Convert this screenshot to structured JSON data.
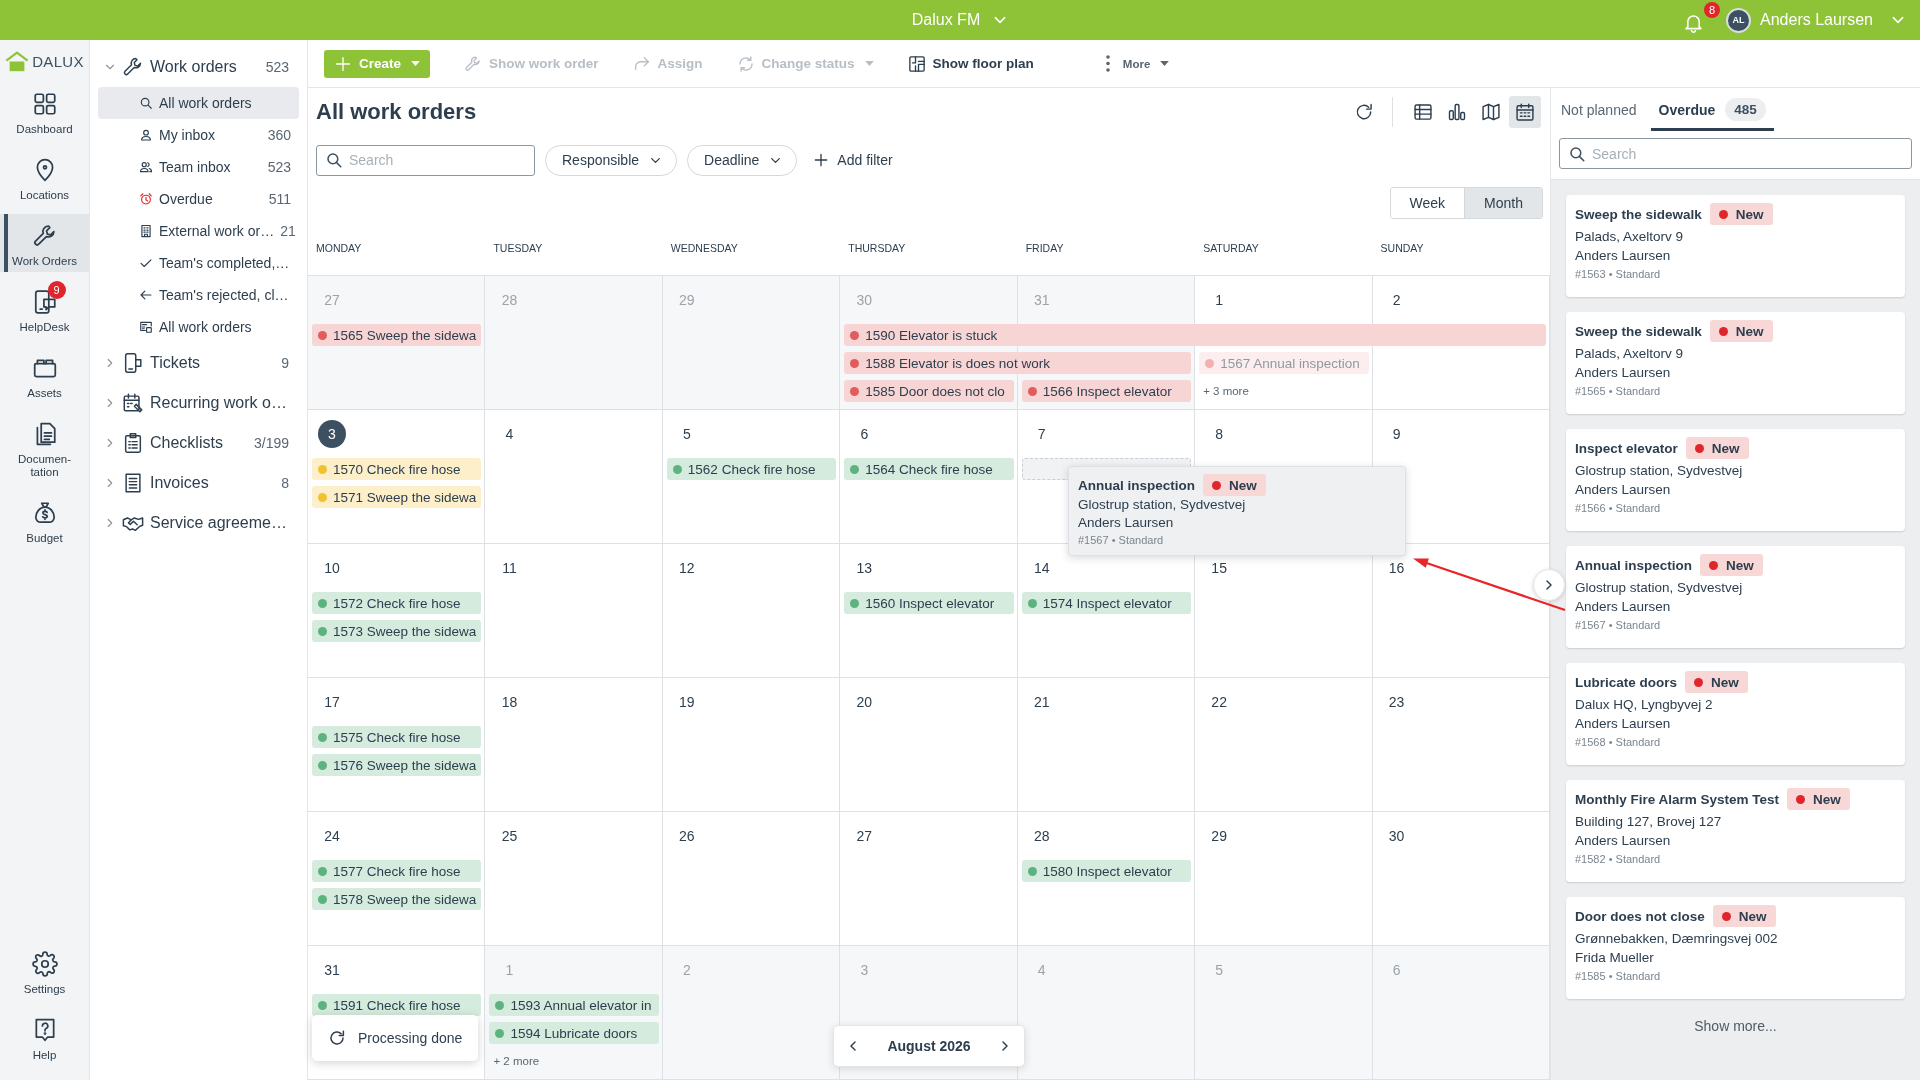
{
  "top_bar": {
    "title": "Dalux FM",
    "notification_count": "8",
    "user": {
      "initials": "AL",
      "name": "Anders Laursen"
    }
  },
  "rail": {
    "logo": "DALUX",
    "items": [
      {
        "label": "Dashboard",
        "selected": false
      },
      {
        "label": "Locations",
        "selected": false
      },
      {
        "label": "Work Orders",
        "selected": true
      },
      {
        "label": "HelpDesk",
        "selected": false,
        "badge": "9"
      },
      {
        "label": "Assets",
        "selected": false
      },
      {
        "label": "Documen-tation",
        "selected": false
      },
      {
        "label": "Budget",
        "selected": false
      }
    ],
    "bottom_items": [
      {
        "label": "Settings"
      },
      {
        "label": "Help"
      }
    ]
  },
  "tree": [
    {
      "label": "Work orders",
      "count": "523",
      "expanded": true,
      "selected": false,
      "children": [
        {
          "label": "All work orders",
          "selected": true
        },
        {
          "label": "My inbox",
          "count": "360",
          "selected": false
        },
        {
          "label": "Team inbox",
          "count": "523",
          "selected": false
        },
        {
          "label": "Overdue",
          "count": "511",
          "selected": false
        },
        {
          "label": "External work or…",
          "count": "21",
          "selected": false
        },
        {
          "label": "Team's completed,…",
          "selected": false
        },
        {
          "label": "Team's rejected, cl…",
          "selected": false
        },
        {
          "label": "All work orders",
          "selected": false
        }
      ]
    },
    {
      "label": "Tickets",
      "count": "9",
      "expanded": false,
      "selected": false
    },
    {
      "label": "Recurring work o…",
      "expanded": false,
      "selected": false
    },
    {
      "label": "Checklists",
      "count": "3/199",
      "expanded": false,
      "selected": false
    },
    {
      "label": "Invoices",
      "count": "8",
      "expanded": false,
      "selected": false
    },
    {
      "label": "Service agreeme…",
      "expanded": false,
      "selected": false
    }
  ],
  "toolbar": {
    "actions": [
      {
        "label": "Create",
        "kind": "primary",
        "disabled": false,
        "dropdown": true
      },
      {
        "label": "Show work order",
        "kind": "plain",
        "disabled": true,
        "dropdown": false
      },
      {
        "label": "Assign",
        "kind": "plain",
        "disabled": true,
        "dropdown": false
      },
      {
        "label": "Change status",
        "kind": "plain",
        "disabled": true,
        "dropdown": true
      },
      {
        "label": "Show floor plan",
        "kind": "plain",
        "disabled": false,
        "dropdown": false
      },
      {
        "label": "More",
        "kind": "plain",
        "disabled": false,
        "dropdown": true
      }
    ]
  },
  "header": {
    "title": "All work orders",
    "views": [
      {
        "selected": false
      },
      {
        "selected": false
      },
      {
        "selected": false
      },
      {
        "selected": true
      }
    ],
    "search": {
      "placeholder": "Search"
    },
    "filters": [
      {
        "label": "Responsible"
      },
      {
        "label": "Deadline"
      }
    ],
    "add_filter": "Add filter",
    "ranges": [
      {
        "label": "Week",
        "selected": false
      },
      {
        "label": "Month",
        "selected": true
      }
    ]
  },
  "calendar": {
    "weekdays": [
      "MONDAY",
      "TUESDAY",
      "WEDNESDAY",
      "THURSDAY",
      "FRIDAY",
      "SATURDAY",
      "SUNDAY"
    ],
    "weeks": [
      {
        "days": [
          {
            "date": "27",
            "outside": true,
            "today": false
          },
          {
            "date": "28",
            "outside": true,
            "today": false
          },
          {
            "date": "29",
            "outside": true,
            "today": false
          },
          {
            "date": "30",
            "outside": true,
            "today": false
          },
          {
            "date": "31",
            "outside": true,
            "today": false
          },
          {
            "date": "1",
            "outside": false,
            "today": false
          },
          {
            "date": "2",
            "outside": false,
            "today": false
          }
        ],
        "lanes": [
          [
            {
              "kind": "event",
              "text": "1565 Sweep the sidewa",
              "color": "#e25c5c",
              "dragging": false
            },
            {
              "kind": "empty"
            },
            {
              "kind": "empty"
            },
            {
              "kind": "event",
              "text": "1590 Elevator is stuck",
              "color": "#e25c5c",
              "dragging": false
            },
            {
              "kind": "continue"
            },
            {
              "kind": "continue"
            },
            {
              "kind": "continue"
            }
          ],
          [
            {
              "kind": "empty"
            },
            {
              "kind": "empty"
            },
            {
              "kind": "empty"
            },
            {
              "kind": "event",
              "text": "1588 Elevator is does not work",
              "color": "#e25c5c",
              "dragging": false
            },
            {
              "kind": "continue"
            },
            {
              "kind": "event",
              "text": "1567 Annual inspection",
              "color": "#f2b1b1",
              "dragging": true
            }
          ],
          [
            {
              "kind": "empty"
            },
            {
              "kind": "empty"
            },
            {
              "kind": "empty"
            },
            {
              "kind": "event",
              "text": "1585 Door does not clo",
              "color": "#e25c5c",
              "dragging": false
            },
            {
              "kind": "event",
              "text": "1566 Inspect elevator",
              "color": "#e25c5c",
              "dragging": false
            },
            {
              "kind": "more",
              "text": "+ 3 more"
            }
          ]
        ]
      },
      {
        "days": [
          {
            "date": "3",
            "outside": false,
            "today": true
          },
          {
            "date": "4",
            "outside": false,
            "today": false
          },
          {
            "date": "5",
            "outside": false,
            "today": false
          },
          {
            "date": "6",
            "outside": false,
            "today": false
          },
          {
            "date": "7",
            "outside": false,
            "today": false
          },
          {
            "date": "8",
            "outside": false,
            "today": false
          },
          {
            "date": "9",
            "outside": false,
            "today": false
          }
        ],
        "lanes": [
          [
            {
              "kind": "event",
              "text": "1570 Check fire hose",
              "color": "#f2c12e",
              "dragging": false
            },
            {
              "kind": "empty"
            },
            {
              "kind": "event",
              "text": "1562 Check fire hose",
              "color": "#5db37e",
              "dragging": false
            },
            {
              "kind": "event",
              "text": "1564 Check fire hose",
              "color": "#5db37e",
              "dragging": false
            },
            {
              "kind": "drop_target"
            }
          ],
          [
            {
              "kind": "event",
              "text": "1571 Sweep the sidewa",
              "color": "#f2c12e",
              "dragging": false
            }
          ]
        ]
      },
      {
        "days": [
          {
            "date": "10",
            "outside": false,
            "today": false
          },
          {
            "date": "11",
            "outside": false,
            "today": false
          },
          {
            "date": "12",
            "outside": false,
            "today": false
          },
          {
            "date": "13",
            "outside": false,
            "today": false
          },
          {
            "date": "14",
            "outside": false,
            "today": false
          },
          {
            "date": "15",
            "outside": false,
            "today": false
          },
          {
            "date": "16",
            "outside": false,
            "today": false
          }
        ],
        "lanes": [
          [
            {
              "kind": "event",
              "text": "1572 Check fire hose",
              "color": "#5db37e",
              "dragging": false
            },
            {
              "kind": "empty"
            },
            {
              "kind": "empty"
            },
            {
              "kind": "event",
              "text": "1560 Inspect elevator",
              "color": "#5db37e",
              "dragging": false
            },
            {
              "kind": "event",
              "text": "1574 Inspect elevator",
              "color": "#5db37e",
              "dragging": false
            }
          ],
          [
            {
              "kind": "event",
              "text": "1573 Sweep the sidewa",
              "color": "#5db37e",
              "dragging": false
            }
          ]
        ]
      },
      {
        "days": [
          {
            "date": "17",
            "outside": false,
            "today": false
          },
          {
            "date": "18",
            "outside": false,
            "today": false
          },
          {
            "date": "19",
            "outside": false,
            "today": false
          },
          {
            "date": "20",
            "outside": false,
            "today": false
          },
          {
            "date": "21",
            "outside": false,
            "today": false
          },
          {
            "date": "22",
            "outside": false,
            "today": false
          },
          {
            "date": "23",
            "outside": false,
            "today": false
          }
        ],
        "lanes": [
          [
            {
              "kind": "event",
              "text": "1575 Check fire hose",
              "color": "#5db37e",
              "dragging": false
            }
          ],
          [
            {
              "kind": "event",
              "text": "1576 Sweep the sidewa",
              "color": "#5db37e",
              "dragging": false
            }
          ]
        ]
      },
      {
        "days": [
          {
            "date": "24",
            "outside": false,
            "today": false
          },
          {
            "date": "25",
            "outside": false,
            "today": false
          },
          {
            "date": "26",
            "outside": false,
            "today": false
          },
          {
            "date": "27",
            "outside": false,
            "today": false
          },
          {
            "date": "28",
            "outside": false,
            "today": false
          },
          {
            "date": "29",
            "outside": false,
            "today": false
          },
          {
            "date": "30",
            "outside": false,
            "today": false
          }
        ],
        "lanes": [
          [
            {
              "kind": "event",
              "text": "1577 Check fire hose",
              "color": "#5db37e",
              "dragging": false
            },
            {
              "kind": "empty"
            },
            {
              "kind": "empty"
            },
            {
              "kind": "empty"
            },
            {
              "kind": "event",
              "text": "1580 Inspect elevator",
              "color": "#5db37e",
              "dragging": false
            }
          ],
          [
            {
              "kind": "event",
              "text": "1578 Sweep the sidewa",
              "color": "#5db37e",
              "dragging": false
            }
          ]
        ]
      },
      {
        "days": [
          {
            "date": "31",
            "outside": false,
            "today": false
          },
          {
            "date": "1",
            "outside": true,
            "today": false
          },
          {
            "date": "2",
            "outside": true,
            "today": false
          },
          {
            "date": "3",
            "outside": true,
            "today": false
          },
          {
            "date": "4",
            "outside": true,
            "today": false
          },
          {
            "date": "5",
            "outside": true,
            "today": false
          },
          {
            "date": "6",
            "outside": true,
            "today": false
          }
        ],
        "lanes": [
          [
            {
              "kind": "event",
              "text": "1591 Check fire hose",
              "color": "#5db37e",
              "dragging": false
            },
            {
              "kind": "event",
              "text": "1593 Annual elevator in",
              "color": "#5db37e",
              "dragging": false
            }
          ],
          [
            {
              "kind": "empty"
            },
            {
              "kind": "event",
              "text": "1594 Lubricate doors",
              "color": "#5db37e",
              "dragging": false
            }
          ],
          [
            {
              "kind": "empty"
            },
            {
              "kind": "more",
              "text": "+ 2 more"
            }
          ]
        ]
      }
    ],
    "drag_preview": {
      "title": "Annual inspection",
      "status": "New",
      "location": "Glostrup station, Sydvestvej",
      "assignee": "Anders Laursen",
      "meta": "#1567 • Standard"
    },
    "toast": "Processing done",
    "month": "August 2026"
  },
  "side_panel": {
    "tabs": [
      {
        "label": "Not planned",
        "selected": false
      },
      {
        "label": "Overdue",
        "count": "485",
        "selected": true
      }
    ],
    "search": {
      "placeholder": "Search"
    },
    "cards": [
      {
        "title": "Sweep the sidewalk",
        "status": "New",
        "location": "Palads, Axeltorv 9",
        "assignee": "Anders Laursen",
        "meta": "#1563 • Standard"
      },
      {
        "title": "Sweep the sidewalk",
        "status": "New",
        "location": "Palads, Axeltorv 9",
        "assignee": "Anders Laursen",
        "meta": "#1565 • Standard"
      },
      {
        "title": "Inspect elevator",
        "status": "New",
        "location": "Glostrup station, Sydvestvej",
        "assignee": "Anders Laursen",
        "meta": "#1566 • Standard"
      },
      {
        "title": "Annual inspection",
        "status": "New",
        "location": "Glostrup station, Sydvestvej",
        "assignee": "Anders Laursen",
        "meta": "#1567 • Standard"
      },
      {
        "title": "Lubricate doors",
        "status": "New",
        "location": "Dalux HQ, Lyngbyvej 2",
        "assignee": "Anders Laursen",
        "meta": "#1568 • Standard"
      },
      {
        "title": "Monthly Fire Alarm System Test",
        "status": "New",
        "location": "Building 127, Brovej 127",
        "assignee": "Anders Laursen",
        "meta": "#1582 • Standard"
      },
      {
        "title": "Door does not close",
        "status": "New",
        "location": "Grønnebakken, Dæmringsvej 002",
        "assignee": "Frida Mueller",
        "meta": "#1585 • Standard"
      }
    ],
    "show_more": "Show more..."
  }
}
